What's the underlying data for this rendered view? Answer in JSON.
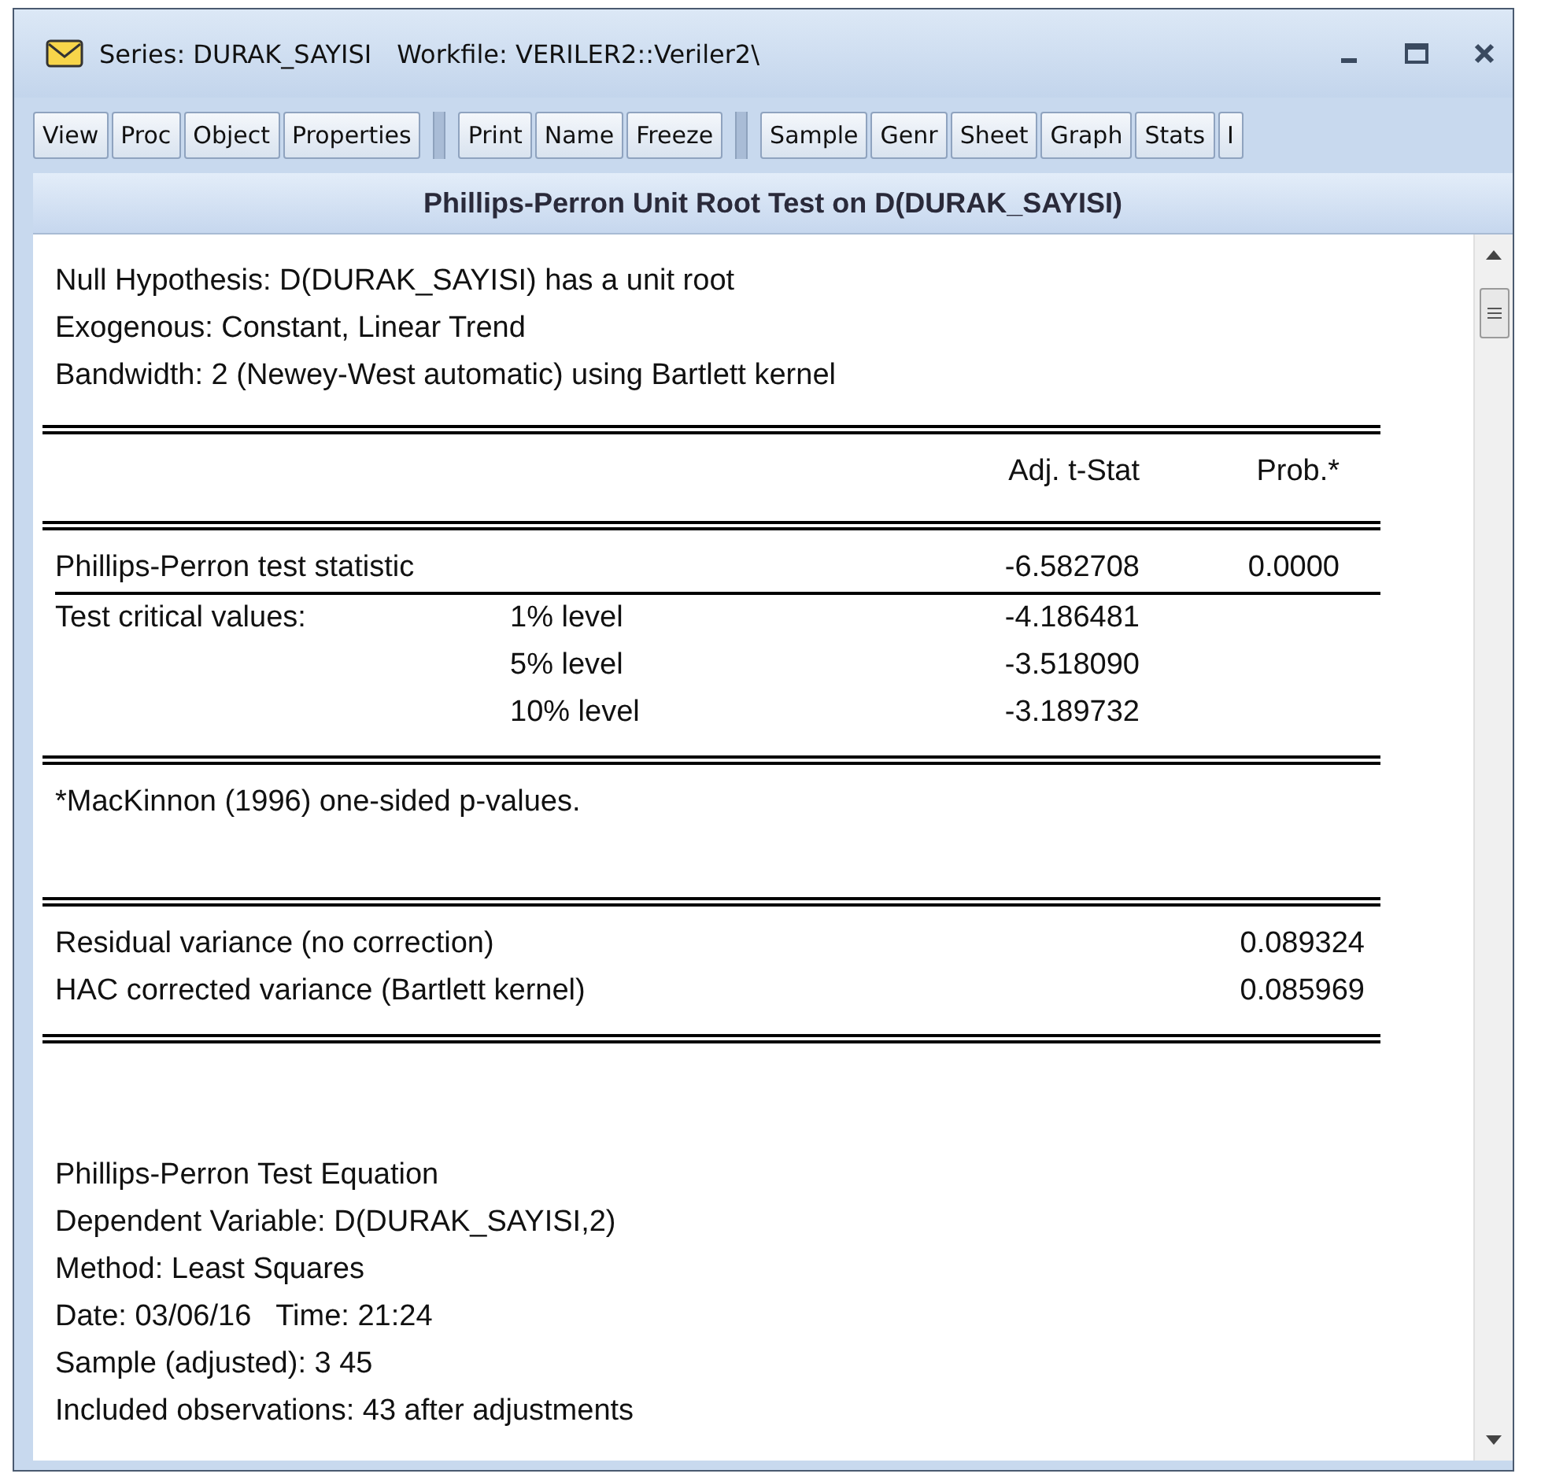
{
  "window": {
    "title": "Series: DURAK_SAYISI",
    "workfile": "Workfile: VERILER2::Veriler2\\"
  },
  "toolbar": [
    [
      "View",
      "Proc",
      "Object",
      "Properties"
    ],
    [
      "Print",
      "Name",
      "Freeze"
    ],
    [
      "Sample",
      "Genr",
      "Sheet",
      "Graph",
      "Stats",
      "I"
    ]
  ],
  "report": {
    "title": "Phillips-Perron Unit Root Test on D(DURAK_SAYISI)",
    "header_lines": [
      "Null Hypothesis: D(DURAK_SAYISI) has a unit root",
      "Exogenous: Constant, Linear Trend",
      "Bandwidth: 2 (Newey-West automatic) using Bartlett kernel"
    ],
    "table": {
      "columns": [
        "Adj. t-Stat",
        "Prob.*"
      ],
      "rows": [
        {
          "label": "Phillips-Perron test statistic",
          "stat": "-6.582708",
          "prob": "0.0000",
          "underlined": true
        },
        {
          "label": "Test critical values:",
          "level": "1% level",
          "stat": "-4.186481",
          "underlined": false
        },
        {
          "level": "5% level",
          "stat": "-3.518090",
          "underlined": false
        },
        {
          "level": "10% level",
          "stat": "-3.189732",
          "underlined": false
        }
      ]
    },
    "note": "*MacKinnon (1996) one-sided p-values.",
    "variances": [
      {
        "label": "Residual variance (no correction)",
        "value": "0.089324"
      },
      {
        "label": "HAC corrected variance (Bartlett kernel)",
        "value": "0.085969"
      }
    ],
    "equation_lines": [
      "Phillips-Perron Test Equation",
      "Dependent Variable: D(DURAK_SAYISI,2)",
      "Method: Least Squares",
      "Date: 03/06/16   Time: 21:24",
      "Sample (adjusted): 3 45",
      "Included observations: 43 after adjustments"
    ]
  }
}
